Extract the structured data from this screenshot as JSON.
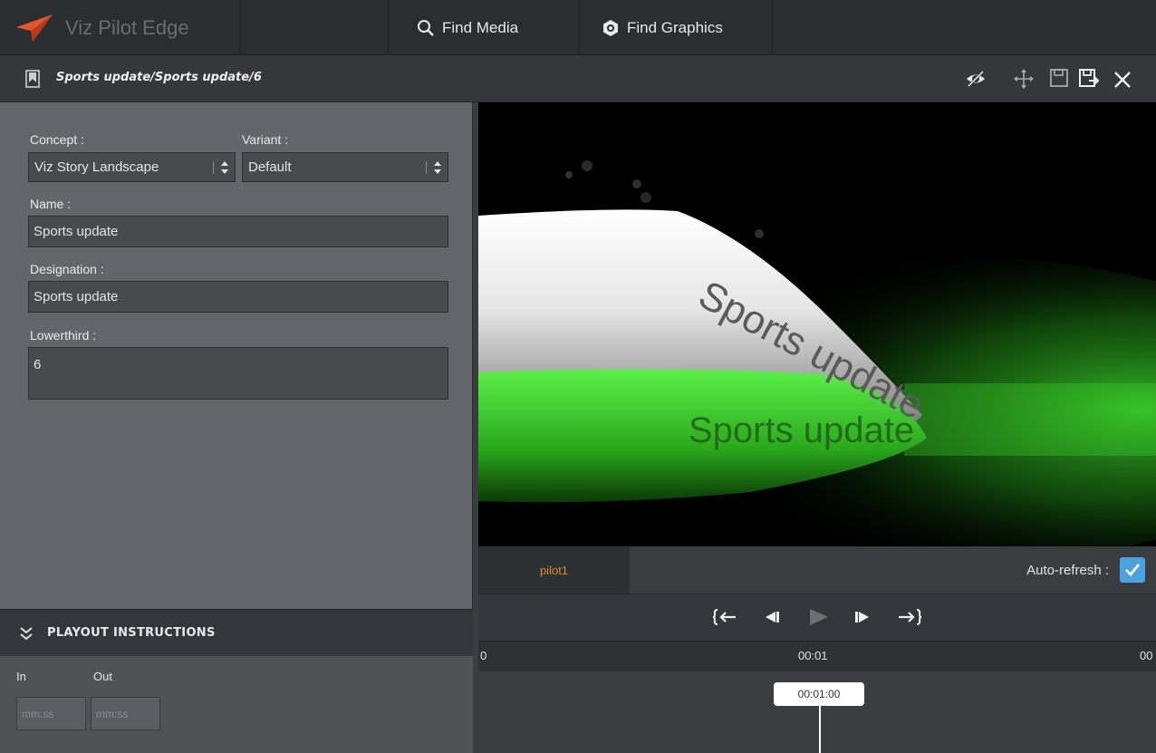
{
  "app": {
    "name": "Viz Pilot Edge"
  },
  "nav": {
    "find_media": "Find Media",
    "find_graphics": "Find Graphics"
  },
  "title": {
    "path": "Sports update/Sports update/6"
  },
  "form": {
    "concept_label": "Concept :",
    "concept_value": "Viz Story Landscape",
    "variant_label": "Variant :",
    "variant_value": "Default",
    "name_label": "Name :",
    "name_value": "Sports update",
    "designation_label": "Designation :",
    "designation_value": "Sports update",
    "lowerthird_label": "Lowerthird :",
    "lowerthird_value": "6"
  },
  "playout": {
    "header": "PLAYOUT INSTRUCTIONS",
    "in_label": "In",
    "out_label": "Out",
    "in_placeholder": "mm:ss",
    "out_placeholder": "mm:ss"
  },
  "preview": {
    "text_main": "Sports update",
    "text_reflection": "Sports update"
  },
  "tabs": {
    "pilot1": "pilot1"
  },
  "autorefresh": {
    "label": "Auto-refresh :",
    "checked": true
  },
  "timeline": {
    "ticks": [
      "0",
      "00:01",
      "00"
    ],
    "playhead": "00:01:00"
  },
  "colors": {
    "accent": "#e08a2a",
    "checkbox": "#4aa3df",
    "glow": "#3bd02a"
  }
}
